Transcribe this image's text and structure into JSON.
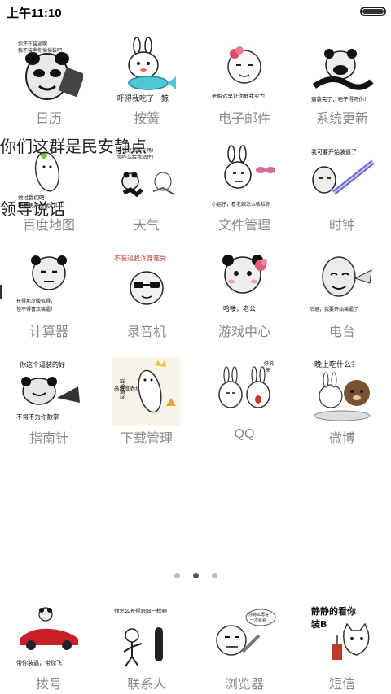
{
  "status_bar": {
    "time": "上午11:10",
    "battery_icon": "battery-icon"
  },
  "apps": [
    {
      "label": "日历",
      "caption": "你还在装逼啊 我不装啊你 偷偷装吧",
      "icon": "panda-meme-icon"
    },
    {
      "label": "按簧",
      "caption": "吓得我吃了一鲸",
      "icon": "rabbit-whale-meme-icon"
    },
    {
      "label": "电子邮件",
      "caption": "老娘迟早让你静我卖力",
      "icon": "flower-face-meme-icon"
    },
    {
      "label": "系统更新",
      "caption": "逼装完了，老子得死你!",
      "icon": "panda-laugh-meme-icon"
    },
    {
      "label": "百度地图",
      "caption": "敢过我们吧！！ 不要再来虐我们！！",
      "icon": "white-blob-meme-icon"
    },
    {
      "label": "天气",
      "caption": "去我这我要在场! 你咋么给我站住!",
      "icon": "panda-run-meme-icon"
    },
    {
      "label": "文件管理",
      "caption": "小姐仔，看老娘怎么收拾你",
      "icon": "rabbit-bra-meme-icon"
    },
    {
      "label": "时钟",
      "caption": "我可要开始装逼了",
      "icon": "sword-meme-icon"
    },
    {
      "label": "计算器",
      "caption": "长得那冷酸似得，怪不得喜欢装逼！",
      "icon": "panda-stare-meme-icon"
    },
    {
      "label": "录音机",
      "caption": "不装逼我浑身难受",
      "icon": "sunglasses-meme-icon"
    },
    {
      "label": "游戏中心",
      "caption": "哈喽，老公",
      "icon": "panda-flower-meme-icon"
    },
    {
      "label": "电台",
      "caption": "后退，我要开始装逼了",
      "icon": "bald-face-meme-icon"
    },
    {
      "label": "指南针",
      "caption": "你这个逼装的好 不得不为你鼓掌",
      "icon": "panda-clap-meme-icon"
    },
    {
      "label": "下载管理",
      "caption": "请勿模仿 高难度表现",
      "icon": "blob-crown-meme-icon"
    },
    {
      "label": "QQ",
      "caption": "好说 来",
      "icon": "two-rabbits-meme-icon"
    },
    {
      "label": "微博",
      "caption": "晚上吃什么?",
      "icon": "cony-brown-meme-icon"
    }
  ],
  "overlay_texts": [
    "你们这群是民安静点",
    "领导说话"
  ],
  "pager": {
    "count": 3,
    "active": 1
  },
  "dock": [
    {
      "label": "拨号",
      "caption": "带你装逼，带你飞",
      "icon": "panda-car-meme-icon"
    },
    {
      "label": "联系人",
      "caption": "你怎么长得跟JB一样啊",
      "icon": "stick-figure-meme-icon"
    },
    {
      "label": "浏览器",
      "caption": "你特么再说一次看看",
      "icon": "face-knife-meme-icon"
    },
    {
      "label": "短信",
      "caption": "静静的看你装B",
      "icon": "cat-drink-meme-icon"
    }
  ],
  "colors": {
    "label": "#8a8a8a",
    "background": "#ffffff",
    "dot_active": "#555555",
    "dot_inactive": "#bdbdbd"
  }
}
